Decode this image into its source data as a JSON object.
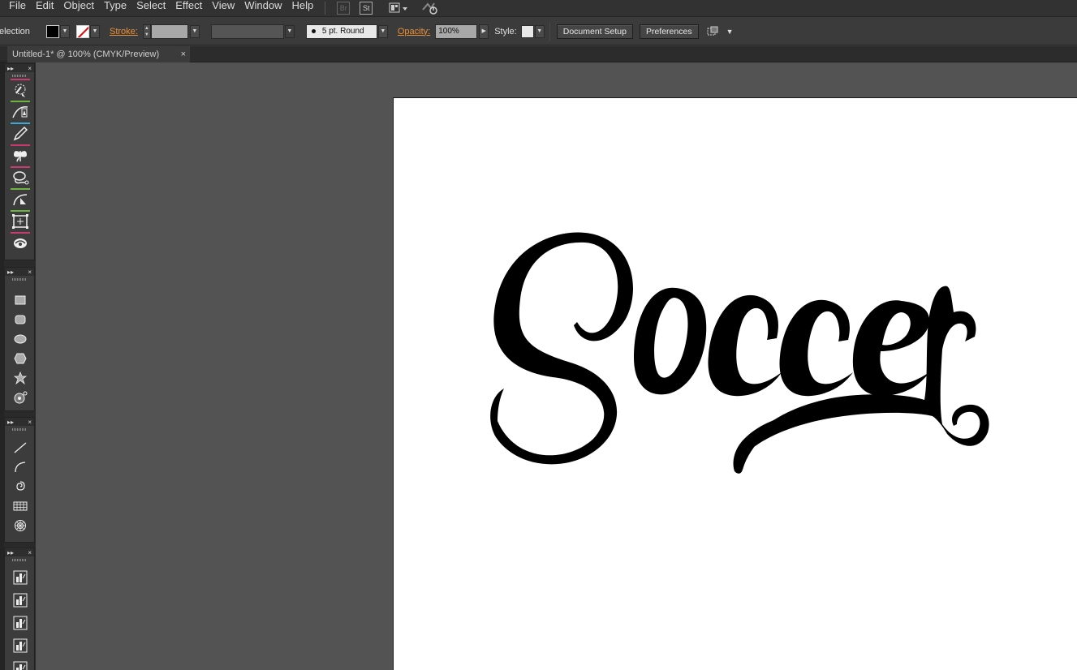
{
  "menu": {
    "items": [
      "File",
      "Edit",
      "Object",
      "Type",
      "Select",
      "Effect",
      "View",
      "Window",
      "Help"
    ],
    "bridge_label": "Br",
    "stock_label": "St",
    "arrange_icon": "arrange-documents-icon",
    "sync_icon": "gpu-performance-icon"
  },
  "control": {
    "selection_label": "election",
    "stroke_label": "Stroke:",
    "brush_value": "5 pt. Round",
    "opacity_label": "Opacity:",
    "opacity_value": "100%",
    "style_label": "Style:",
    "document_setup_label": "Document Setup",
    "preferences_label": "Preferences",
    "fill_color": "#000000",
    "stroke_color": "none"
  },
  "tab": {
    "title": "Untitled-1* @ 100% (CMYK/Preview)",
    "close": "×"
  },
  "panels": {
    "head_expand": "▸▸",
    "head_close": "×"
  },
  "artwork": {
    "text": "Soccer"
  },
  "colors": {
    "accent_link": "#e8913a",
    "artboard": "#ffffff",
    "pasteboard": "#535353"
  }
}
